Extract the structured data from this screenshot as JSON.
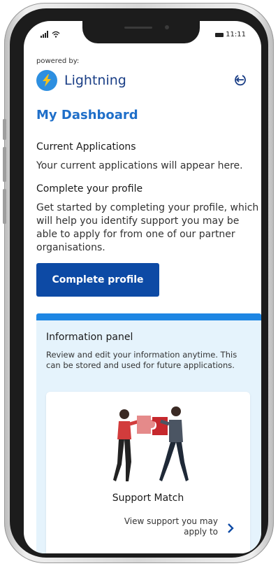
{
  "status": {
    "time": "11:11"
  },
  "header": {
    "powered_by": "powered by:",
    "brand_name": "Lightning"
  },
  "dashboard": {
    "title": "My Dashboard",
    "current_applications_heading": "Current Applications",
    "current_applications_text": "Your current applications will appear here.",
    "complete_profile_heading": "Complete your profile",
    "complete_profile_text": "Get started by completing your profile, which will help you identify support you may be able to apply for from one of our partner organisations.",
    "complete_profile_button": "Complete profile"
  },
  "info_panel": {
    "title": "Information panel",
    "description": "Review and edit your information anytime. This can be stored and used for future applications.",
    "card": {
      "title": "Support Match",
      "link_text": "View support you may apply to"
    }
  },
  "colors": {
    "primary": "#0d4aa5",
    "accent": "#1d86e3",
    "panel_bg": "#e5f3fc",
    "title_blue": "#1f6fc9"
  },
  "icons": [
    "signal-icon",
    "wifi-icon",
    "battery-icon",
    "lightning-logo-icon",
    "logout-icon",
    "chevron-right-icon",
    "puzzle-illustration"
  ]
}
